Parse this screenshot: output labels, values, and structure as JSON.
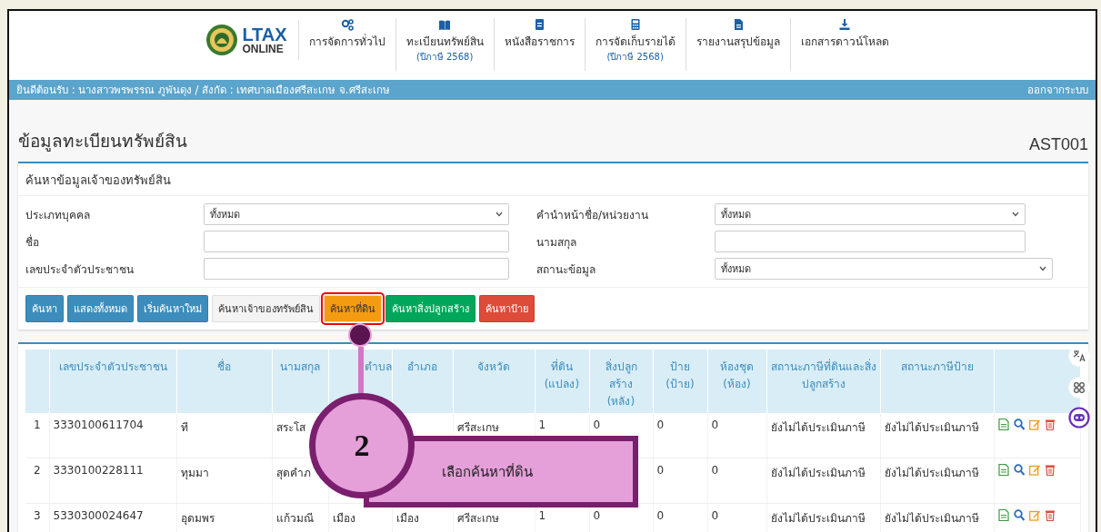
{
  "header": {
    "logo": {
      "title": "LTAX",
      "subtitle": "ONLINE"
    },
    "nav": [
      {
        "label": "การจัดการทั่วไป"
      },
      {
        "label": "ทะเบียนทรัพย์สิน",
        "sub": "(ปีภาษี 2568)"
      },
      {
        "label": "หนังสือราชการ"
      },
      {
        "label": "การจัดเก็บรายได้",
        "sub": "(ปีภาษี 2568)"
      },
      {
        "label": "รายงานสรุปข้อมูล"
      },
      {
        "label": "เอกสารดาวน์โหลด"
      }
    ]
  },
  "welcome_bar": {
    "text": "ยินดีต้อนรับ : นางสาวพรพรรณ ภูพันดุง / สังกัด : เทศบาลเมืองศรีสะเกษ จ.ศรีสะเกษ",
    "logout": "ออกจากระบบ"
  },
  "page": {
    "title": "ข้อมูลทะเบียนทรัพย์สิน",
    "code": "AST001"
  },
  "search": {
    "title": "ค้นหาข้อมูลเจ้าของทรัพย์สิน",
    "fields": [
      {
        "label": "ประเภทบุคคล",
        "kind": "select",
        "value": "ทั้งหมด"
      },
      {
        "label": "คำนำหน้าชื่อ/หน่วยงาน",
        "kind": "select",
        "value": "ทั้งหมด"
      },
      {
        "label": "ชื่อ",
        "kind": "text"
      },
      {
        "label": "นามสกุล",
        "kind": "text"
      },
      {
        "label": "เลขประจำตัวประชาชน",
        "kind": "text"
      },
      {
        "label": "สถานะข้อมูล",
        "kind": "select",
        "value": "ทั้งหมด"
      }
    ],
    "buttons": [
      {
        "label": "ค้นหา",
        "color": "#3c8dbc",
        "highlighted": false
      },
      {
        "label": "แสดงทั้งหมด",
        "color": "#3c8dbc",
        "highlighted": false
      },
      {
        "label": "เริ่มค้นหาใหม่",
        "color": "#3c8dbc",
        "highlighted": false
      },
      {
        "label": "ค้นหาเจ้าของทรัพย์สิน",
        "color": "#f4f4f4",
        "highlighted": false
      },
      {
        "label": "ค้นหาที่ดิน",
        "color": "#f39c12",
        "highlighted": true
      },
      {
        "label": "ค้นหาสิ่งปลูกสร้าง",
        "color": "#00a65a",
        "highlighted": false
      },
      {
        "label": "ค้นหาป้าย",
        "color": "#dd4b39",
        "highlighted": false
      }
    ]
  },
  "table": {
    "columns": [
      "เลขประจำตัวประชาชน",
      "ชื่อ",
      "นามสกุล",
      "ตำบล",
      "อำเภอ",
      "จังหวัด",
      "ที่ดิน\n(แปลง)",
      "สิ่งปลูก\nสร้าง\n(หลัง)",
      "ป้าย\n(ป้าย)",
      "ห้องชุด\n(ห้อง)",
      "สถานะภาษีที่ดินและสิ่ง\nปลูกสร้าง",
      "สถานะภาษีป้าย"
    ],
    "rows": [
      {
        "no": "1",
        "cells": [
          "3330100611704",
          "ที",
          "สระโส",
          null,
          null,
          "ศรีสะเกษ",
          "1",
          "0",
          "0",
          "0",
          "ยังไม่ได้ประเมินภาษี",
          "ยังไม่ได้ประเมินภาษี"
        ]
      },
      {
        "no": "2",
        "cells": [
          "3330100228111",
          "ทุมมา",
          "สุดคำภ",
          null,
          null,
          null,
          null,
          null,
          "0",
          "0",
          "ยังไม่ได้ประเมินภาษี",
          "ยังไม่ได้ประเมินภาษี"
        ]
      },
      {
        "no": "3",
        "cells": [
          "5330300024647",
          "อุดมพร",
          "แก้วมณี",
          "เมือง",
          "เมือง",
          "ศรีสะเกษ",
          "1",
          "0",
          "0",
          "0",
          "ยังไม่ได้ประเมินภาษี",
          "ยังไม่ได้ประเมินภาษี"
        ]
      }
    ]
  },
  "callout": {
    "number": "2",
    "text": "เลือกค้นหาที่ดิน"
  }
}
